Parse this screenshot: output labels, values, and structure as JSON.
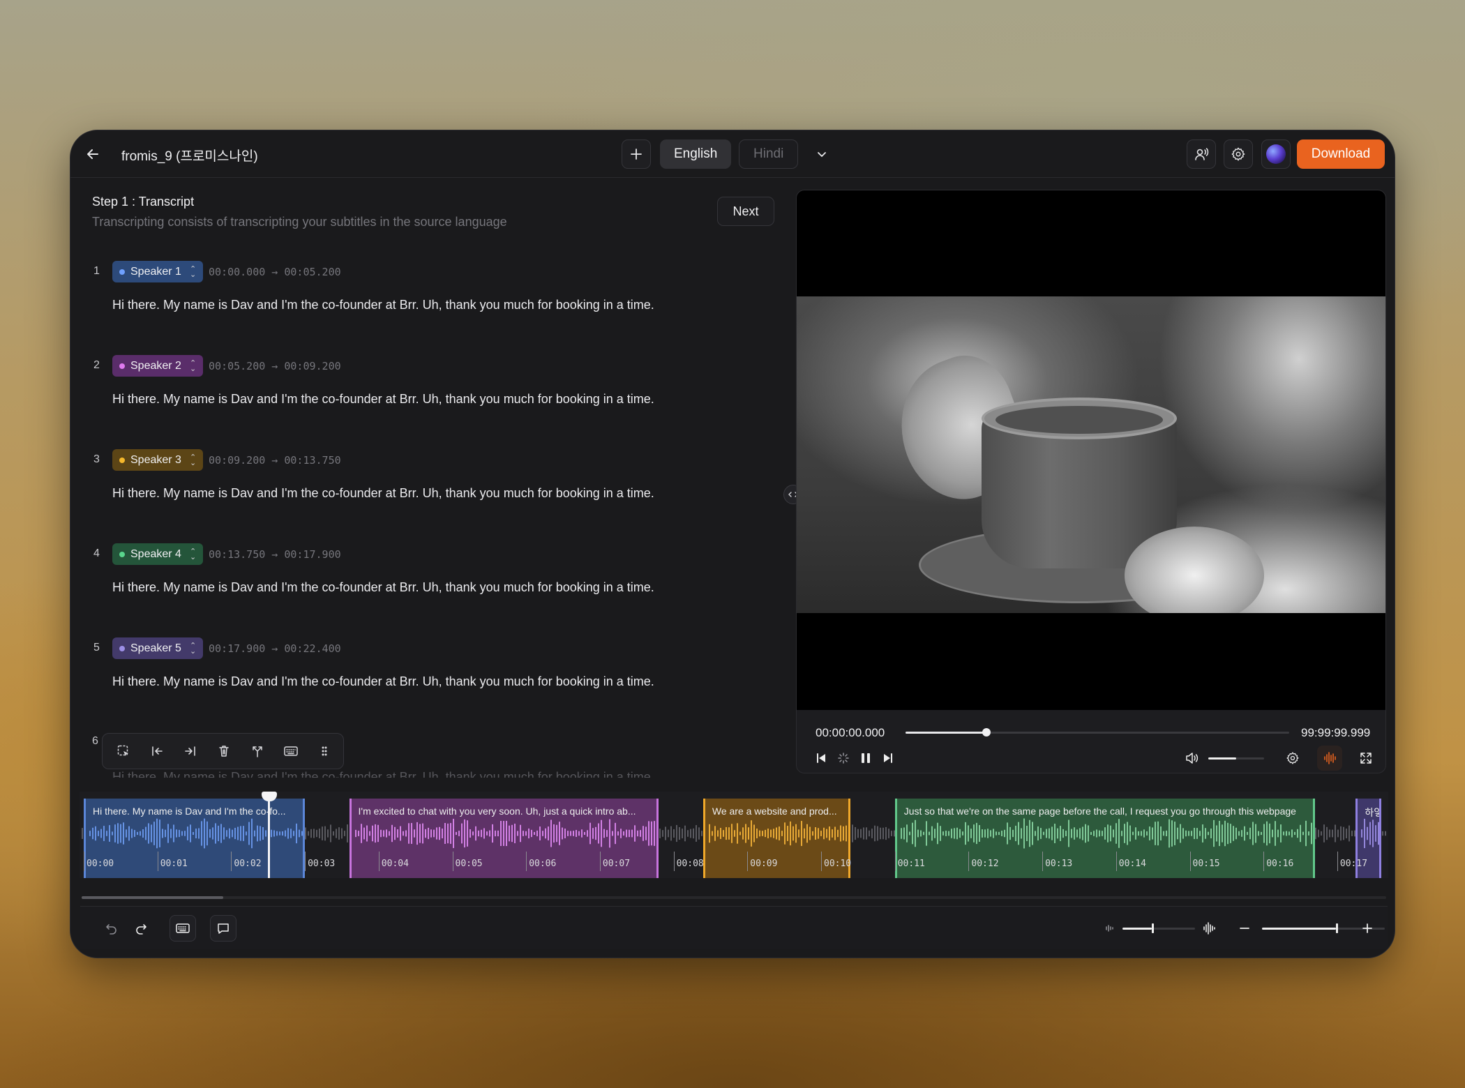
{
  "header": {
    "title": "fromis_9 (프로미스나인)",
    "tabs": [
      "English",
      "Hindi"
    ],
    "download_label": "Download"
  },
  "step": {
    "title": "Step 1 : Transcript",
    "subtitle": "Transcripting consists of transcripting your subtitles in the source language",
    "next_label": "Next"
  },
  "segments": [
    {
      "num": "1",
      "speaker": "Speaker 1",
      "time": "00:00.000 → 00:05.200",
      "color": "#2d4a7a",
      "dot": "#6fa0ff",
      "text": "Hi there. My name is Dav and I'm the co-founder at Brr. Uh, thank you much for booking in a time."
    },
    {
      "num": "2",
      "speaker": "Speaker 2",
      "time": "00:05.200 → 00:09.200",
      "color": "#5a2d6a",
      "dot": "#e07af0",
      "text": "Hi there. My name is Dav and I'm the co-founder at Brr. Uh, thank you much for booking in a time."
    },
    {
      "num": "3",
      "speaker": "Speaker 3",
      "time": "00:09.200 → 00:13.750",
      "color": "#5c4516",
      "dot": "#f5b82c",
      "text": "Hi there. My name is Dav and I'm the co-founder at Brr. Uh, thank you much for booking in a time."
    },
    {
      "num": "4",
      "speaker": "Speaker 4",
      "time": "00:13.750 → 00:17.900",
      "color": "#24553a",
      "dot": "#59d68d",
      "text": "Hi there. My name is Dav and I'm the co-founder at Brr. Uh, thank you much for booking in a time."
    },
    {
      "num": "5",
      "speaker": "Speaker 5",
      "time": "00:17.900 → 00:22.400",
      "color": "#433a6a",
      "dot": "#9d8fe6",
      "text": "Hi there. My name is Dav and I'm the co-founder at Brr. Uh, thank you much for booking in a time."
    }
  ],
  "segment6": {
    "num": "6",
    "text": "Hi there. My name is Dav and I'm the co-founder at Brr. Uh, thank you much for booking in a time."
  },
  "video": {
    "current_time": "00:00:00.000",
    "total_time": "99:99:99.999",
    "progress": 0.21,
    "volume": 0.5
  },
  "timeline": {
    "clips": [
      {
        "label": "Hi there. My name is Dav and I'm the co-fo...",
        "start": 0.0,
        "end": 3.0,
        "fill": "#2f4a78",
        "border": "#5b86d8",
        "wave": "#6d9bf0"
      },
      {
        "label": "I'm excited to chat with you very soon. Uh, just a quick intro ab...",
        "start": 3.6,
        "end": 7.8,
        "fill": "#5e3267",
        "border": "#c874de",
        "wave": "#e08af2"
      },
      {
        "label": "We are a website and prod...",
        "start": 8.4,
        "end": 10.4,
        "fill": "#6b4a17",
        "border": "#f0a82a",
        "wave": "#f6b43a"
      },
      {
        "label": "Just so that we're on the same page before the call, I request you go through this webpage",
        "start": 11.0,
        "end": 16.7,
        "fill": "#2d5a3c",
        "border": "#62c98b",
        "wave": "#8ad6a3"
      },
      {
        "label": "하얗",
        "start": 17.25,
        "end": 17.6,
        "fill": "#3f386a",
        "border": "#8f80e0",
        "wave": "#9d8fe6"
      }
    ],
    "ticks": [
      "00:00",
      "00:01",
      "00:02",
      "00:03",
      "00:04",
      "00:05",
      "00:06",
      "00:07",
      "00:08",
      "00:09",
      "00:10",
      "00:11",
      "00:12",
      "00:13",
      "00:14",
      "00:15",
      "00:16",
      "00:17"
    ],
    "playhead_time": 2.5
  },
  "bottom": {
    "wave_zoom": 0.4,
    "timeline_zoom": 0.6
  }
}
